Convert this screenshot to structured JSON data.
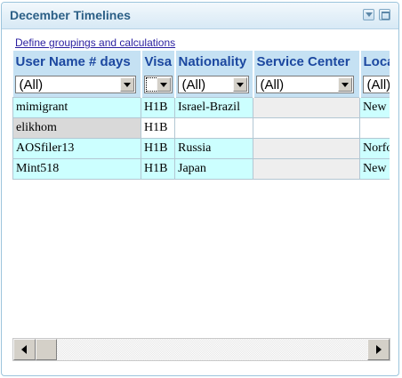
{
  "panel": {
    "title": "December Timelines",
    "collapse_icon": "chevron-down-icon",
    "maximize_icon": "window-maximize-icon"
  },
  "link": {
    "define": "Define groupings and calculations"
  },
  "grid": {
    "columns": [
      {
        "key": "user",
        "label": "User Name # days",
        "filter": "(All)"
      },
      {
        "key": "visa",
        "label": "Visa",
        "filter": ""
      },
      {
        "key": "nationality",
        "label": "Nationality",
        "filter": "(All)"
      },
      {
        "key": "service_center",
        "label": "Service Center",
        "filter": "(All)"
      },
      {
        "key": "location",
        "label": "Location",
        "filter": "(All)"
      }
    ],
    "rows": [
      {
        "user": "mimigrant",
        "visa": "H1B",
        "nationality": "Israel-Brazil",
        "service_center": "",
        "location": "New"
      },
      {
        "user": "elikhom",
        "visa": "H1B",
        "nationality": "",
        "service_center": "",
        "location": ""
      },
      {
        "user": "AOSfiler13",
        "visa": "H1B",
        "nationality": "Russia",
        "service_center": "",
        "location": "Norfo"
      },
      {
        "user": "Mint518",
        "visa": "H1B",
        "nationality": "Japan",
        "service_center": "",
        "location": "New"
      }
    ]
  },
  "scrollbar": {
    "left_icon": "arrow-left-icon",
    "right_icon": "arrow-right-icon"
  },
  "colors": {
    "header_bg": "#c5e1f3",
    "header_text": "#1c48a0",
    "row_highlight": "#ccffff",
    "title_text": "#2b5f86"
  }
}
